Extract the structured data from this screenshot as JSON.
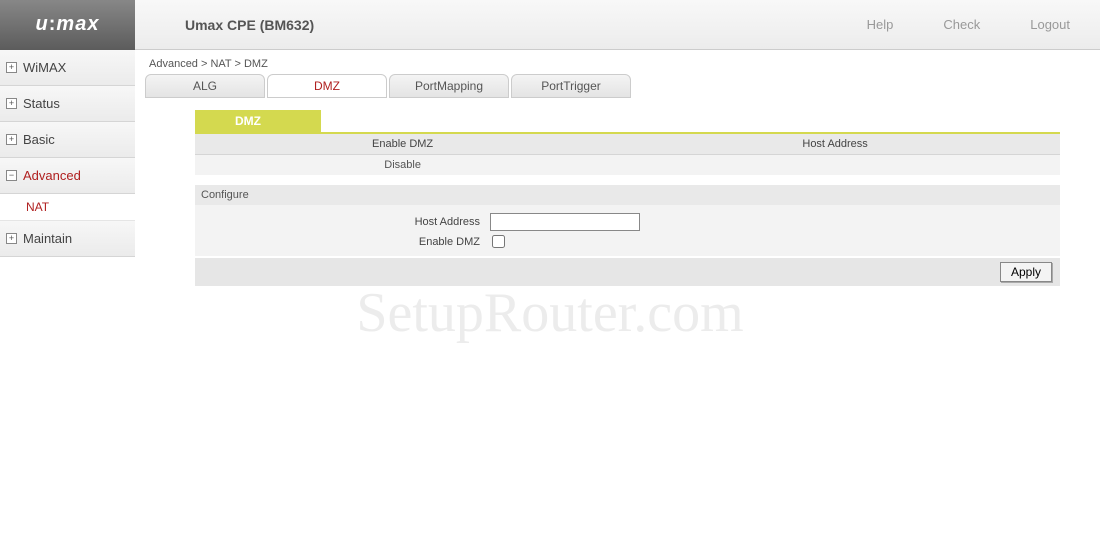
{
  "header": {
    "logo": "u:max",
    "title": "Umax CPE (BM632)",
    "links": {
      "help": "Help",
      "check": "Check",
      "logout": "Logout"
    }
  },
  "sidebar": {
    "items": [
      {
        "label": "WiMAX",
        "expanded": false
      },
      {
        "label": "Status",
        "expanded": false
      },
      {
        "label": "Basic",
        "expanded": false
      },
      {
        "label": "Advanced",
        "expanded": true,
        "active": true,
        "children": [
          {
            "label": "NAT"
          }
        ]
      },
      {
        "label": "Maintain",
        "expanded": false
      }
    ]
  },
  "breadcrumb": "Advanced > NAT > DMZ",
  "tabs": [
    {
      "label": "ALG",
      "active": false
    },
    {
      "label": "DMZ",
      "active": true
    },
    {
      "label": "PortMapping",
      "active": false
    },
    {
      "label": "PortTrigger",
      "active": false
    }
  ],
  "section_title": "DMZ",
  "status_table": {
    "headers": {
      "col1": "Enable DMZ",
      "col2": "Host Address"
    },
    "row": {
      "col1": "Disable",
      "col2": ""
    }
  },
  "configure": {
    "title": "Configure",
    "fields": {
      "host_address_label": "Host Address",
      "host_address_value": "",
      "enable_dmz_label": "Enable DMZ",
      "enable_dmz_checked": false
    },
    "apply_label": "Apply"
  },
  "watermark": "SetupRouter.com"
}
